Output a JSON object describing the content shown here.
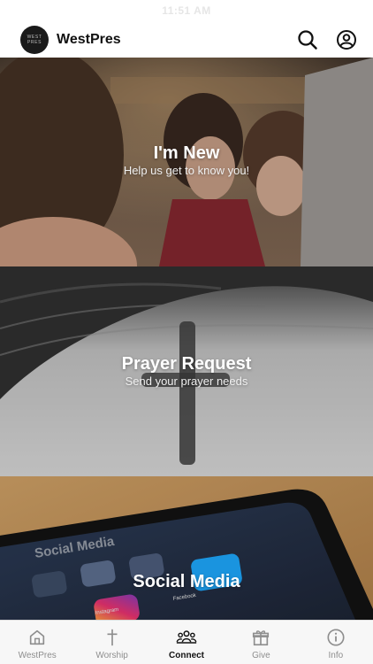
{
  "status_bar": {
    "time": "11:51 AM"
  },
  "header": {
    "logo_lines": [
      "WEST",
      "PRES"
    ],
    "title": "WestPres",
    "actions": [
      {
        "icon": "search-icon"
      },
      {
        "icon": "profile-icon"
      }
    ]
  },
  "tiles": [
    {
      "title": "I'm New",
      "subtitle": "Help us get to know you!"
    },
    {
      "title": "Prayer Request",
      "subtitle": "Send your prayer needs"
    },
    {
      "title": "Social Media"
    }
  ],
  "social_photo_labels": [
    "Social Media",
    "Instagram",
    "Facebook"
  ],
  "tab_bar": {
    "active_color": "#111111",
    "inactive_color": "#8e8e8e",
    "tabs": [
      {
        "label": "WestPres",
        "icon": "home-icon",
        "active": false
      },
      {
        "label": "Worship",
        "icon": "cross-icon",
        "active": false
      },
      {
        "label": "Connect",
        "icon": "people-icon",
        "active": true
      },
      {
        "label": "Give",
        "icon": "gift-icon",
        "active": false
      },
      {
        "label": "Info",
        "icon": "info-icon",
        "active": false
      }
    ]
  }
}
